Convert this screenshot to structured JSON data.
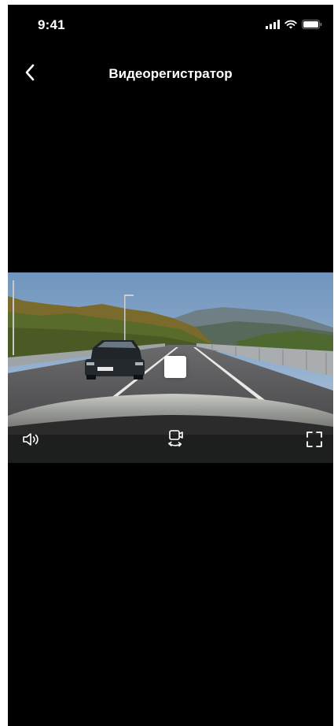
{
  "status_bar": {
    "time": "9:41",
    "icons": [
      "signal-icon",
      "wifi-icon",
      "battery-icon"
    ]
  },
  "nav": {
    "back_icon": "chevron-left-icon",
    "title": "Видеорегистратор"
  },
  "video": {
    "overlay_icon": "stop-icon",
    "controls": [
      "speaker-icon",
      "switch-camera-icon",
      "fullscreen-icon"
    ]
  },
  "colors": {
    "background": "#000000",
    "text": "#ffffff"
  }
}
